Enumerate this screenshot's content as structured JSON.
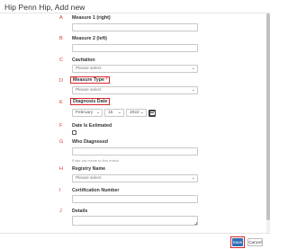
{
  "dialog": {
    "title": "Hip Penn Hip, Add new"
  },
  "fields": {
    "measure1": {
      "letter": "A",
      "label": "Measure 1 (right)",
      "value": ""
    },
    "measure2": {
      "letter": "B",
      "label": "Measure 2 (left)",
      "value": ""
    },
    "cavitation": {
      "letter": "C",
      "label": "Cavitation",
      "selected": "Please select"
    },
    "measure_type": {
      "letter": "D",
      "label": "Measure Type",
      "required_marker": "*",
      "selected": "Please select"
    },
    "diagnosis_date": {
      "letter": "E",
      "label": "Diagnosis Date",
      "month": "February",
      "day": "15",
      "year": "2022"
    },
    "date_estimated": {
      "letter": "F",
      "label": "Date Is Estimated",
      "checked": false
    },
    "who_diagnosed": {
      "letter": "G",
      "label": "Who Diagnosed",
      "value": "",
      "hint": "Enter last name to find match"
    },
    "registry_name": {
      "letter": "H",
      "label": "Registry Name",
      "selected": "Please select"
    },
    "certification_number": {
      "letter": "I",
      "label": "Certification Number",
      "value": ""
    },
    "details": {
      "letter": "J",
      "label": "Details",
      "value": ""
    }
  },
  "footer": {
    "save_label": "Save",
    "cancel_label": "Cancel"
  },
  "icons": {
    "chevron": "chevron-down-icon",
    "calendar": "calendar-icon"
  },
  "colors": {
    "accent": "#2f6fb5",
    "highlight": "#d9272d",
    "letters": "#e0342f"
  }
}
